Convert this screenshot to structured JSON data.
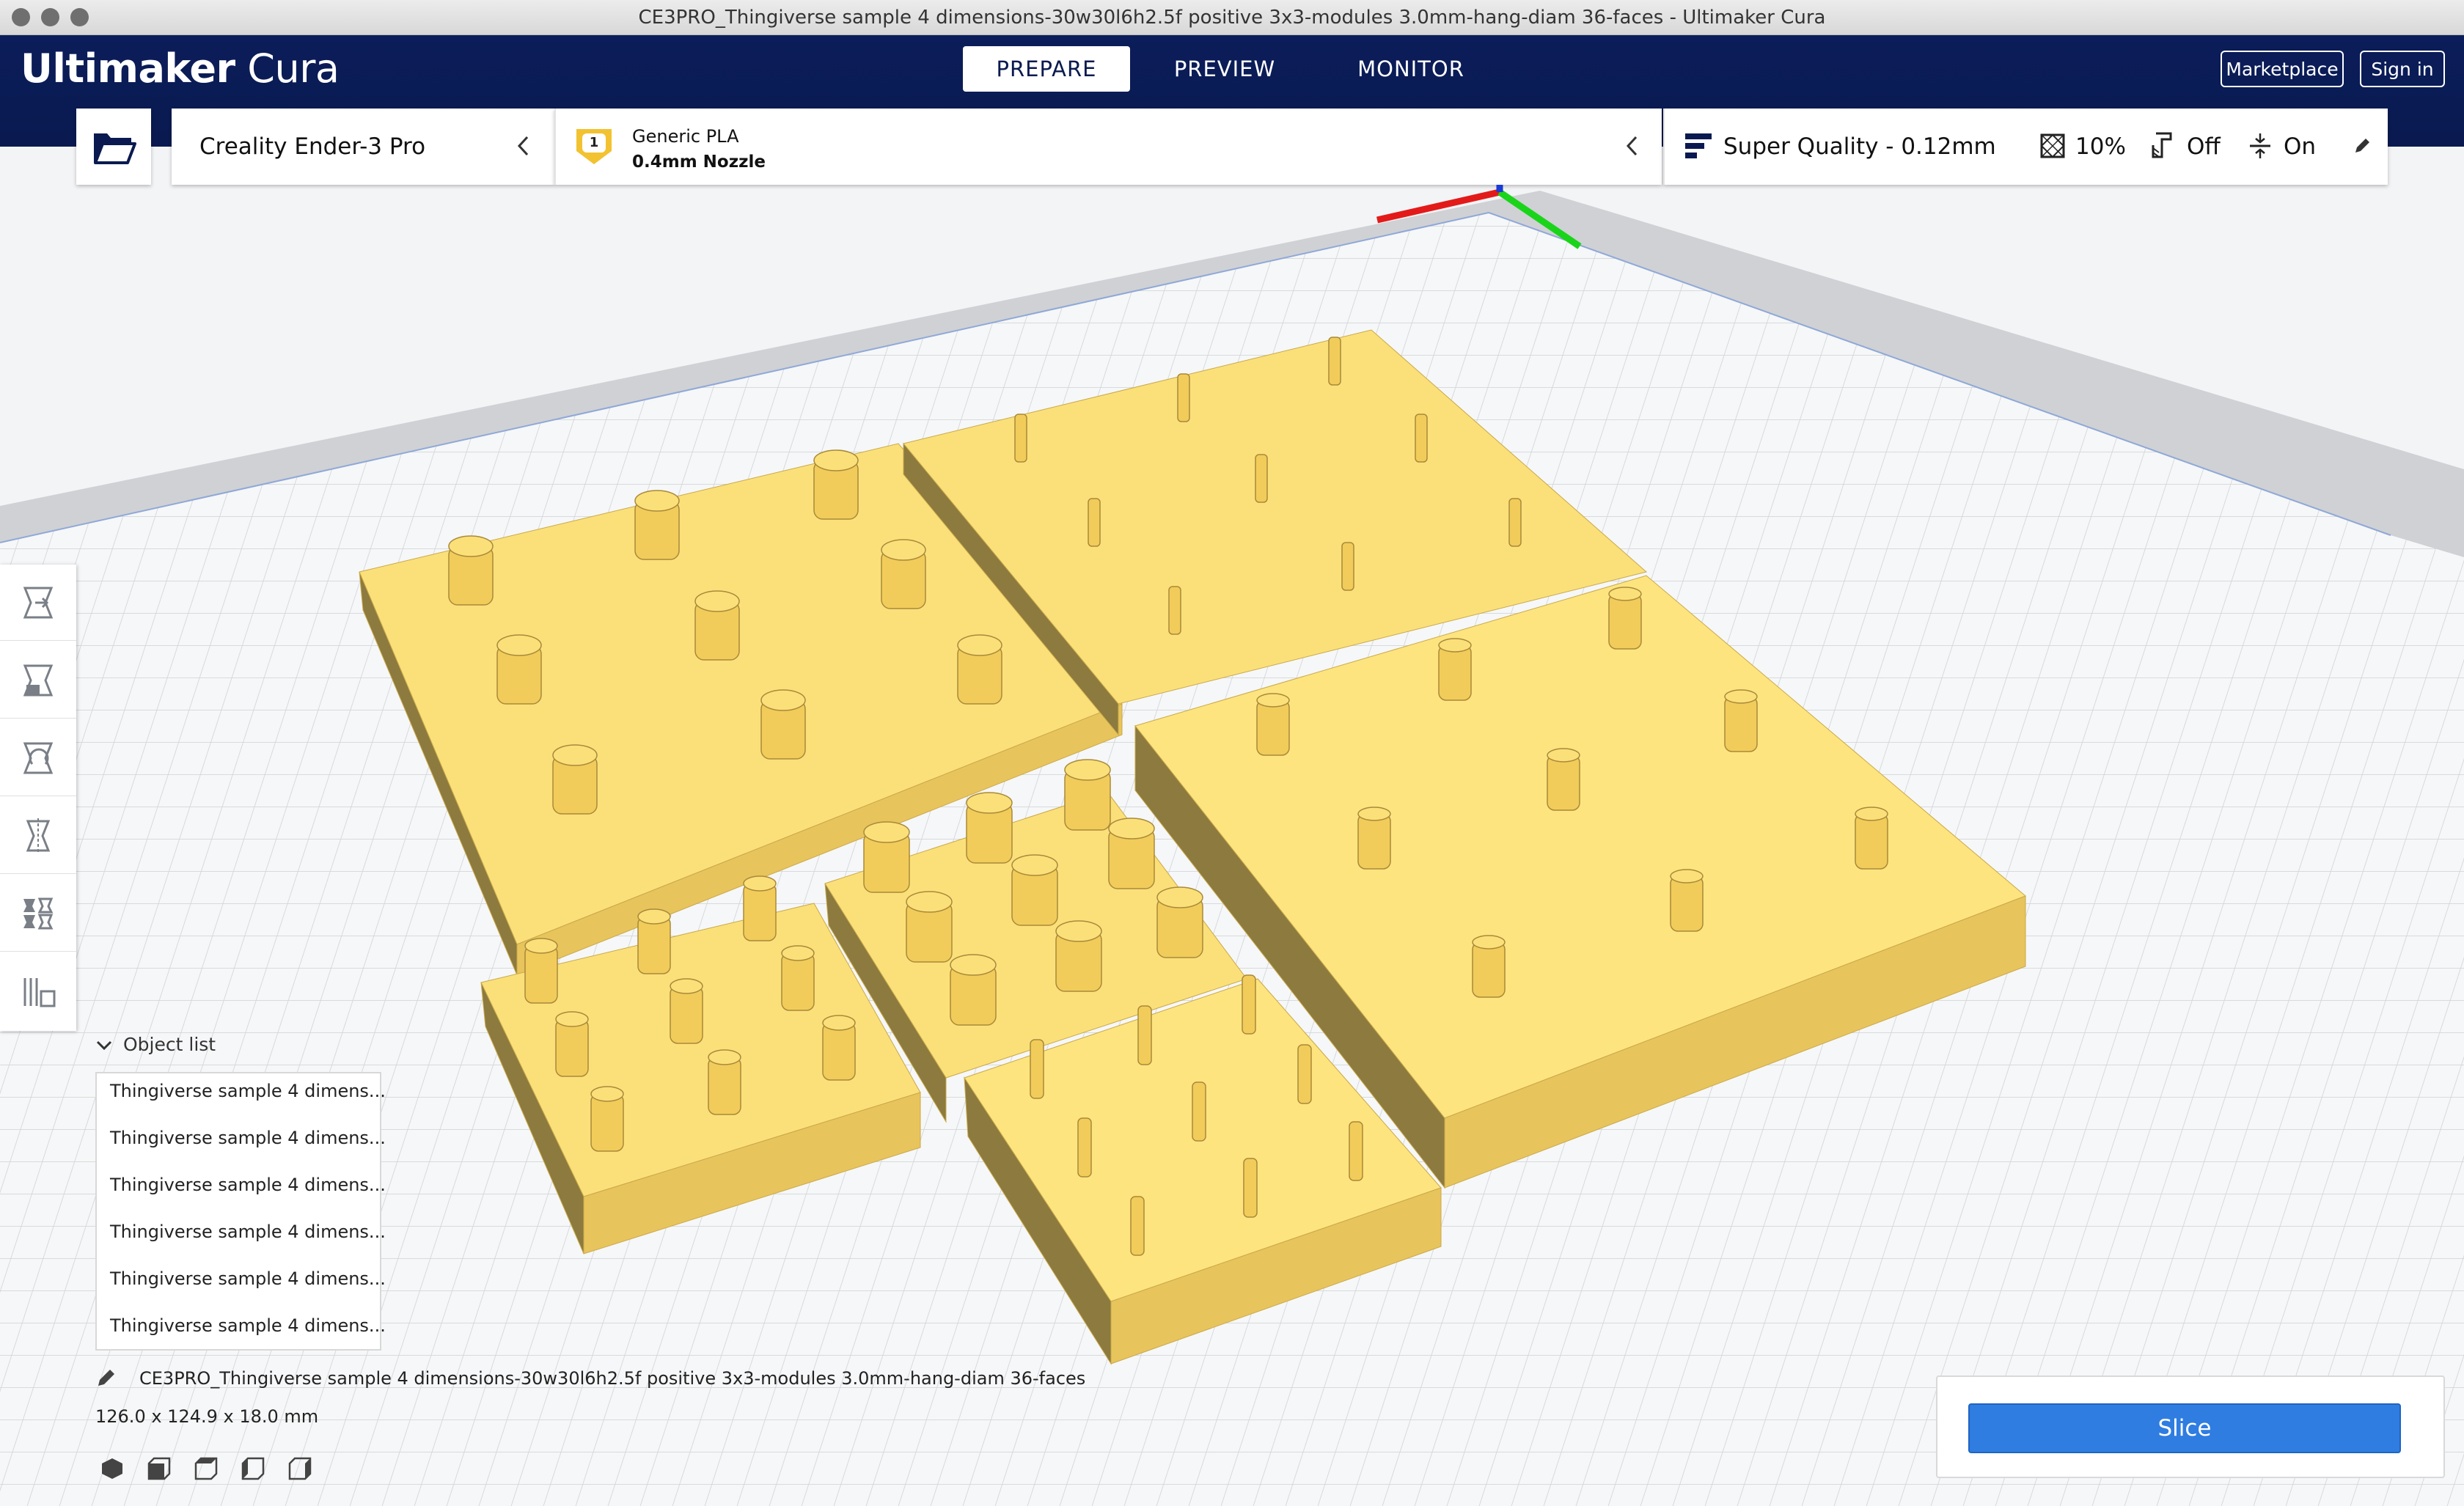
{
  "window": {
    "title": "CE3PRO_Thingiverse sample 4 dimensions-30w30l6h2.5f positive 3x3-modules 3.0mm-hang-diam 36-faces - Ultimaker Cura"
  },
  "header": {
    "logo_bold": "Ultimaker",
    "logo_light": " Cura",
    "tabs": [
      {
        "label": "PREPARE",
        "active": true
      },
      {
        "label": "PREVIEW",
        "active": false
      },
      {
        "label": "MONITOR",
        "active": false
      }
    ],
    "marketplace_label": "Marketplace",
    "signin_label": "Sign in"
  },
  "printer": {
    "name": "Creality Ender-3 Pro"
  },
  "material": {
    "extruder_number": "1",
    "name": "Generic PLA",
    "nozzle": "0.4mm Nozzle"
  },
  "print_settings": {
    "profile": "Super Quality - 0.12mm",
    "infill": "10%",
    "support": "Off",
    "adhesion": "On"
  },
  "tools": [
    {
      "name": "move-tool",
      "icon": "move-icon"
    },
    {
      "name": "scale-tool",
      "icon": "scale-icon"
    },
    {
      "name": "rotate-tool",
      "icon": "rotate-icon"
    },
    {
      "name": "mirror-tool",
      "icon": "mirror-icon"
    },
    {
      "name": "per-model-settings-tool",
      "icon": "per-model-settings-icon"
    },
    {
      "name": "support-blocker-tool",
      "icon": "support-blocker-icon"
    }
  ],
  "object_list": {
    "title": "Object list",
    "items": [
      "Thingiverse sample 4 dimens...",
      "Thingiverse sample 4 dimens...",
      "Thingiverse sample 4 dimens...",
      "Thingiverse sample 4 dimens...",
      "Thingiverse sample 4 dimens...",
      "Thingiverse sample 4 dimens..."
    ]
  },
  "job": {
    "name": "CE3PRO_Thingiverse sample 4 dimensions-30w30l6h2.5f positive 3x3-modules 3.0mm-hang-diam 36-faces",
    "dimensions": "126.0 x 124.9 x 18.0 mm"
  },
  "view_buttons": [
    "3d-view-icon",
    "front-view-icon",
    "top-view-icon",
    "left-view-icon",
    "right-view-icon"
  ],
  "slice_label": "Slice",
  "colors": {
    "header_bg": "#0a1a50",
    "model_yellow": "#f6d86a",
    "slice_blue": "#2f7de1",
    "axis_x": "#e31a1a",
    "axis_y": "#1ad41a",
    "axis_z": "#1a3ad4"
  }
}
